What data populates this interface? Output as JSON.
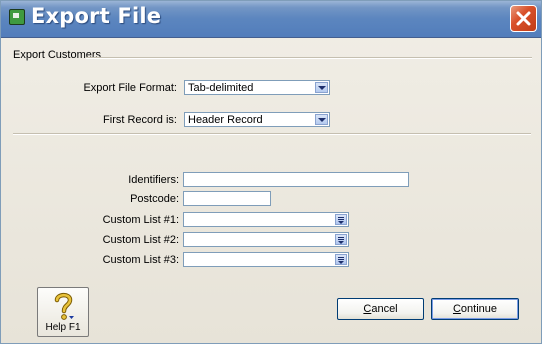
{
  "window": {
    "title": "Export File"
  },
  "group": {
    "title": "Export Customers"
  },
  "export_format": {
    "label": "Export File Format:",
    "value": "Tab-delimited"
  },
  "first_record": {
    "label": "First Record is:",
    "value": "Header Record"
  },
  "identifiers": {
    "label": "Identifiers:",
    "value": ""
  },
  "postcode": {
    "label": "Postcode:",
    "value": ""
  },
  "custom_list_1": {
    "label": "Custom List #1:",
    "value": ""
  },
  "custom_list_2": {
    "label": "Custom List #2:",
    "value": ""
  },
  "custom_list_3": {
    "label": "Custom List #3:",
    "value": ""
  },
  "help": {
    "label": "Help F1",
    "icon": "question-mark-icon"
  },
  "buttons": {
    "cancel": {
      "accel": "C",
      "rest": "ancel"
    },
    "continue": {
      "accel": "C",
      "rest": "ontinue"
    }
  },
  "colors": {
    "titlebar": "#5c86bf",
    "close": "#d9512b",
    "help_icon": "#c9a227"
  }
}
